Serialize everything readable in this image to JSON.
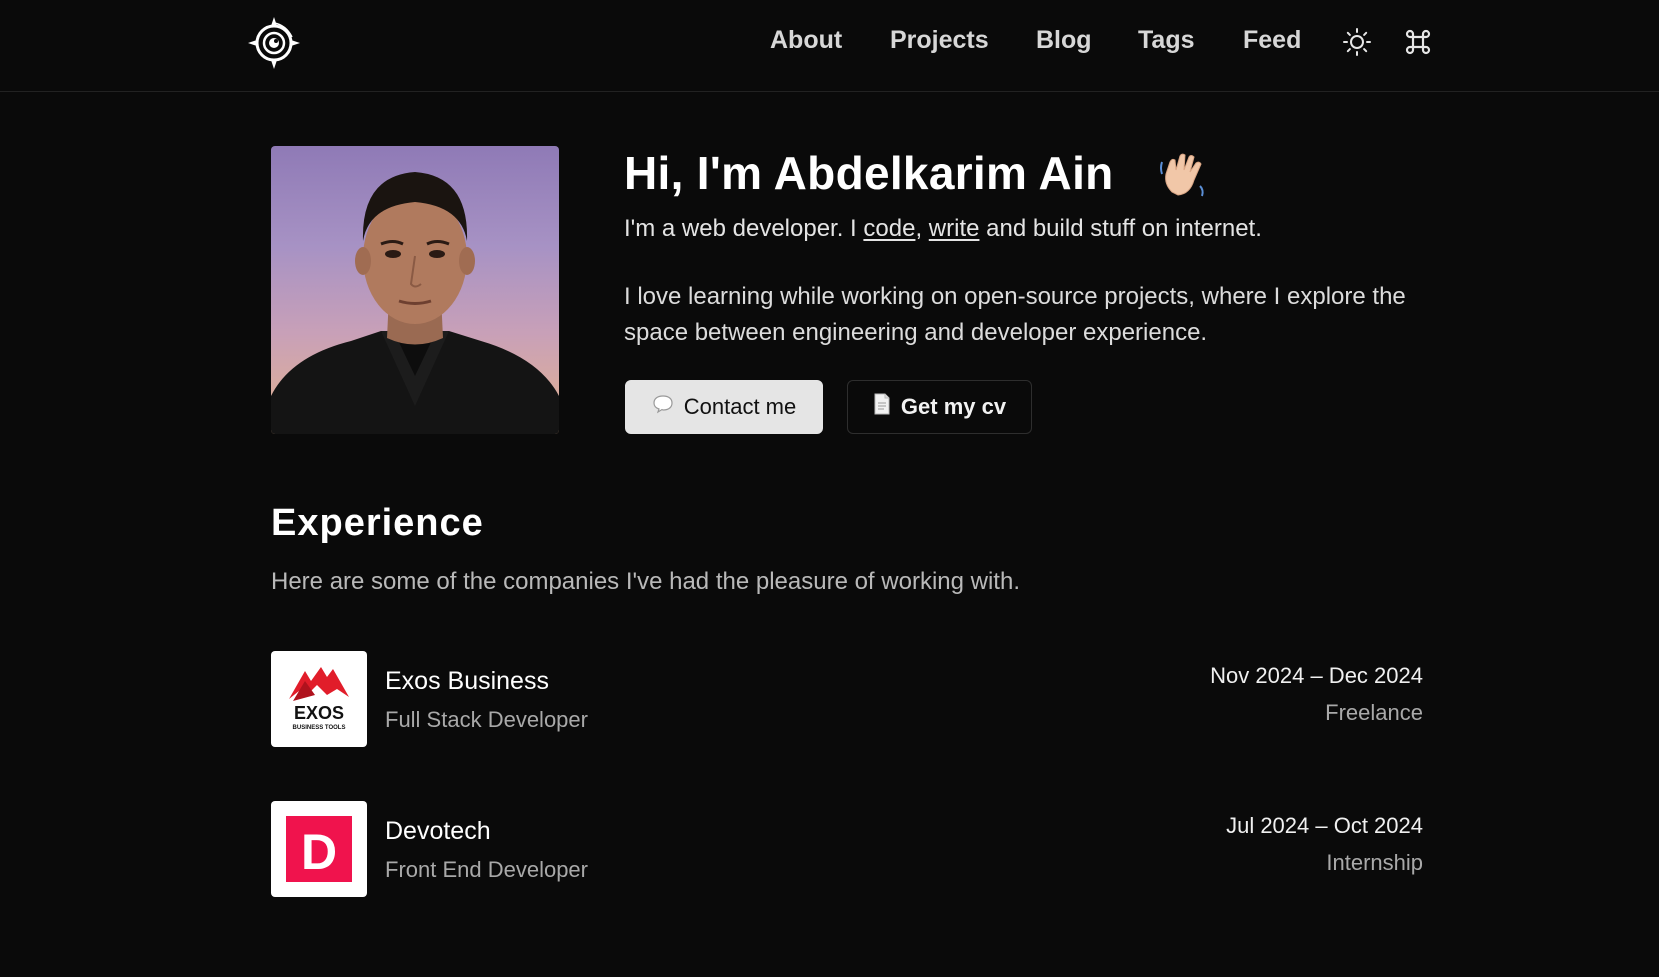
{
  "nav": {
    "logo_icon": "compass-logo-icon",
    "links": [
      "About",
      "Projects",
      "Blog",
      "Tags",
      "Feed"
    ],
    "theme_icon": "sun-icon",
    "command_icon": "command-icon"
  },
  "hero": {
    "title": "Hi, I'm Abdelkarim Ain",
    "wave_icon": "waving-hand-emoji",
    "sub_prefix": "I'm a web developer. I ",
    "sub_code": "code",
    "sub_comma": ", ",
    "sub_write": "write",
    "sub_suffix": " and build stuff on internet.",
    "paragraph": "I love learning while working on open-source projects, where I explore the space between engineering and developer experience.",
    "contact_label": "Contact me",
    "contact_icon": "speech-bubble-icon",
    "cv_label": "Get my cv",
    "cv_icon": "document-icon"
  },
  "experience": {
    "title": "Experience",
    "subtitle": "Here are some of the companies I've had the pleasure of working with.",
    "items": [
      {
        "company": "Exos Business",
        "role": "Full Stack Developer",
        "dates": "Nov 2024 – Dec 2024",
        "type": "Freelance",
        "logo_text": "EXOS",
        "logo_subtext": "BUSINESS TOOLS",
        "logo_color": "#e11d2a"
      },
      {
        "company": "Devotech",
        "role": "Front End Developer",
        "dates": "Jul 2024 – Oct 2024",
        "type": "Internship",
        "logo_text": "D",
        "logo_color": "#f0134d"
      }
    ]
  },
  "colors": {
    "background": "#0a0a0a",
    "text": "#f2f2f2",
    "muted": "#a9a9a9"
  }
}
